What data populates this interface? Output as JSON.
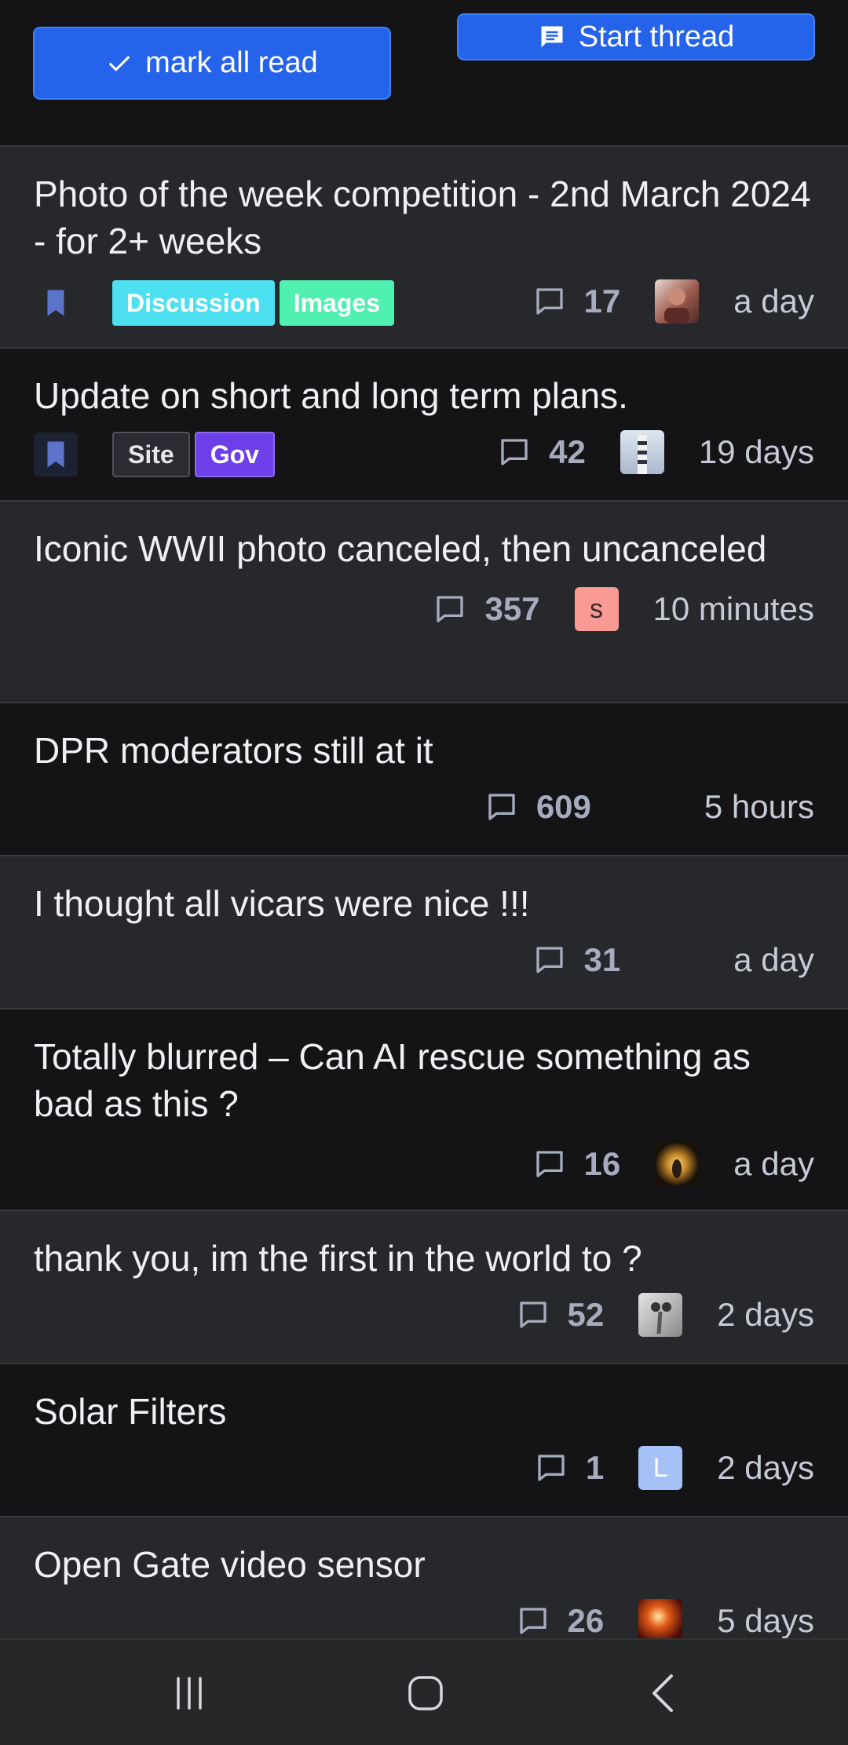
{
  "toolbar": {
    "mark_all_read_label": "mark all read",
    "start_thread_label": "Start thread",
    "button_color": "#2563eb"
  },
  "threads": [
    {
      "title": "Photo of the week competition - 2nd March 2024 - for 2+ weeks",
      "bookmark": true,
      "tags": [
        {
          "label": "Discussion",
          "bg": "#4de0f0",
          "fg": "#ffffff"
        },
        {
          "label": "Images",
          "bg": "#4ff0b0",
          "fg": "#ffffff"
        }
      ],
      "replies": "17",
      "avatar": "photo-portrait",
      "last_activity": "a day"
    },
    {
      "title": "Update on short and long term plans.",
      "bookmark": true,
      "tags": [
        {
          "label": "Site",
          "bg": "#2b2c31",
          "fg": "#e5e7eb"
        },
        {
          "label": "Gov",
          "bg": "#6d3fe8",
          "fg": "#ffffff"
        }
      ],
      "replies": "42",
      "avatar": "photo-lighthouse",
      "last_activity": "19 days"
    },
    {
      "title": "Iconic WWII photo canceled, then uncanceled",
      "replies": "357",
      "avatar_letter": "s",
      "avatar_color": "#f99a94",
      "last_activity": "10 minutes"
    },
    {
      "title": "DPR moderators still at it",
      "replies": "609",
      "last_activity": "5 hours"
    },
    {
      "title": "I thought all vicars were nice !!!",
      "replies": "31",
      "last_activity": "a day"
    },
    {
      "title": "Totally blurred – Can AI rescue something as bad as this ?",
      "replies": "16",
      "avatar": "photo-burst",
      "last_activity": "a day"
    },
    {
      "title": "thank you, im the first in the world to ?",
      "replies": "52",
      "avatar": "photo-insect",
      "last_activity": "2 days"
    },
    {
      "title": "Solar Filters",
      "replies": "1",
      "avatar_letter": "L",
      "avatar_color": "#a6c1f5",
      "last_activity": "2 days"
    },
    {
      "title": "Open Gate video sensor",
      "replies": "26",
      "avatar": "photo-fire",
      "last_activity": "5 days"
    }
  ],
  "navbar": {
    "icons": [
      "recent-apps-icon",
      "home-icon",
      "back-icon"
    ]
  }
}
